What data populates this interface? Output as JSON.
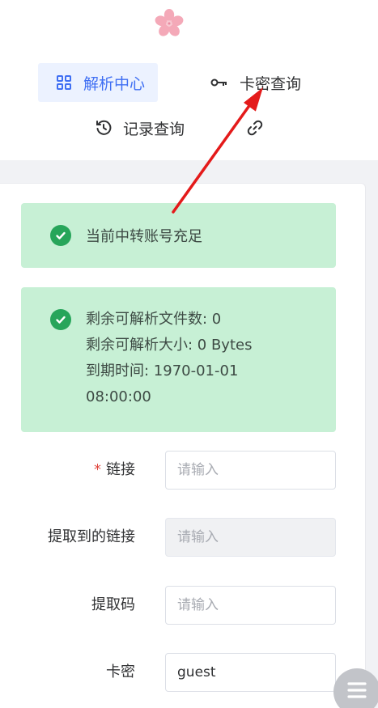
{
  "nav": {
    "parse_center": "解析中心",
    "card_query": "卡密查询",
    "record_query": "记录查询"
  },
  "alerts": {
    "account_status": "当前中转账号充足",
    "quota_lines": [
      "剩余可解析文件数: 0",
      "剩余可解析大小: 0 Bytes",
      "到期时间: 1970-01-01",
      "08:00:00"
    ]
  },
  "form": {
    "link": {
      "required_mark": "*",
      "label": "链接",
      "placeholder": "请输入",
      "value": ""
    },
    "extracted_link": {
      "label": "提取到的链接",
      "placeholder": "请输入",
      "value": ""
    },
    "extract_code": {
      "label": "提取码",
      "placeholder": "请输入",
      "value": ""
    },
    "card_key": {
      "label": "卡密",
      "placeholder": "",
      "value": "guest"
    }
  },
  "icons": {
    "logo": "cherry-blossom-icon",
    "parse": "grid-icon",
    "card": "key-icon",
    "record": "history-icon",
    "link": "link-icon",
    "alert": "check-circle-icon",
    "float": "menu-icon"
  },
  "colors": {
    "accent": "#3f6ff3",
    "active_nav_bg": "#ecf2ff",
    "success_bg": "#c7f0d5",
    "success_icon": "#27a55a",
    "required": "#e0473f",
    "annotation_arrow": "#e41a1a"
  }
}
